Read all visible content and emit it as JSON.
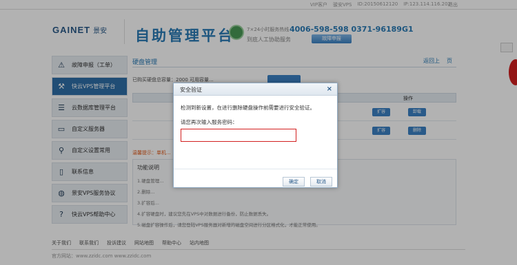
{
  "topbar": {
    "items": [
      "VIP客户",
      "骏安VPS",
      "ID:20150612120",
      "IP:123.114.116.202"
    ],
    "exit_label": "退出"
  },
  "header": {
    "brand": "GAINET",
    "brand_cn": "景安",
    "platform_title": "自助管理平台",
    "hotline_label": "7×24小时服务热线",
    "hotline_number": "4006-598-598  0371-96189G1",
    "manual_label": "到底人工协助服务",
    "report_button": "故障申报"
  },
  "sidebar": {
    "items": [
      {
        "label": "故障申报（工单）",
        "icon": "warning-icon",
        "active": false
      },
      {
        "label": "快云VPS管理平台",
        "icon": "wrench-icon",
        "active": true
      },
      {
        "label": "云数据库管理平台",
        "icon": "database-icon",
        "active": false
      },
      {
        "label": "自定义服务器",
        "icon": "server-icon",
        "active": false
      },
      {
        "label": "自定义设置常用",
        "icon": "search-icon",
        "active": false
      },
      {
        "label": "联系信息",
        "icon": "phone-icon",
        "active": false
      },
      {
        "label": "景安VPS服务协议",
        "icon": "globe-icon",
        "active": false
      },
      {
        "label": "快云VPS帮助中心",
        "icon": "help-icon",
        "active": false
      }
    ]
  },
  "main": {
    "title": "硬盘管理",
    "links": [
      "返回上",
      "页"
    ],
    "info": "已购买硬盘总容量：2000  可用容量...",
    "operation_header": "操作",
    "rows": [
      {
        "act1": "扩容",
        "act2": "卸载"
      },
      {
        "act1": "扩容",
        "act2": "删除"
      }
    ],
    "hint": "温馨提示：单机...",
    "func_title": "功能说明",
    "func_lines": [
      "1.硬盘管理...",
      "2.删除...",
      "3.扩容后...",
      "4.扩容硬盘时，建议您先在VPS中对数据进行备份，防止数据丢失。",
      "5.磁盘扩容操作后，请您登陆VPS服务器对新增的磁盘空间进行分区格式化，才能正常使用。"
    ]
  },
  "footer": {
    "links": [
      "关于我们",
      "联系我们",
      "投诉建议",
      "网站地图",
      "帮助中心",
      "站内地图"
    ],
    "line2": "官方网站：www.zzidc.com    www.zzidc.com"
  },
  "modal": {
    "title": "安全验证",
    "close_icon": "close-icon",
    "text": "检测到新设置，在进行删除硬盘操作前需要进行安全验证。",
    "prompt": "请您再次输入服务密码：",
    "input_value": "",
    "confirm": "确定",
    "cancel": "取消"
  },
  "colors": {
    "accent": "#2a7bb6",
    "active_nav": "#2e6fa8",
    "input_border": "#d21f1f"
  }
}
